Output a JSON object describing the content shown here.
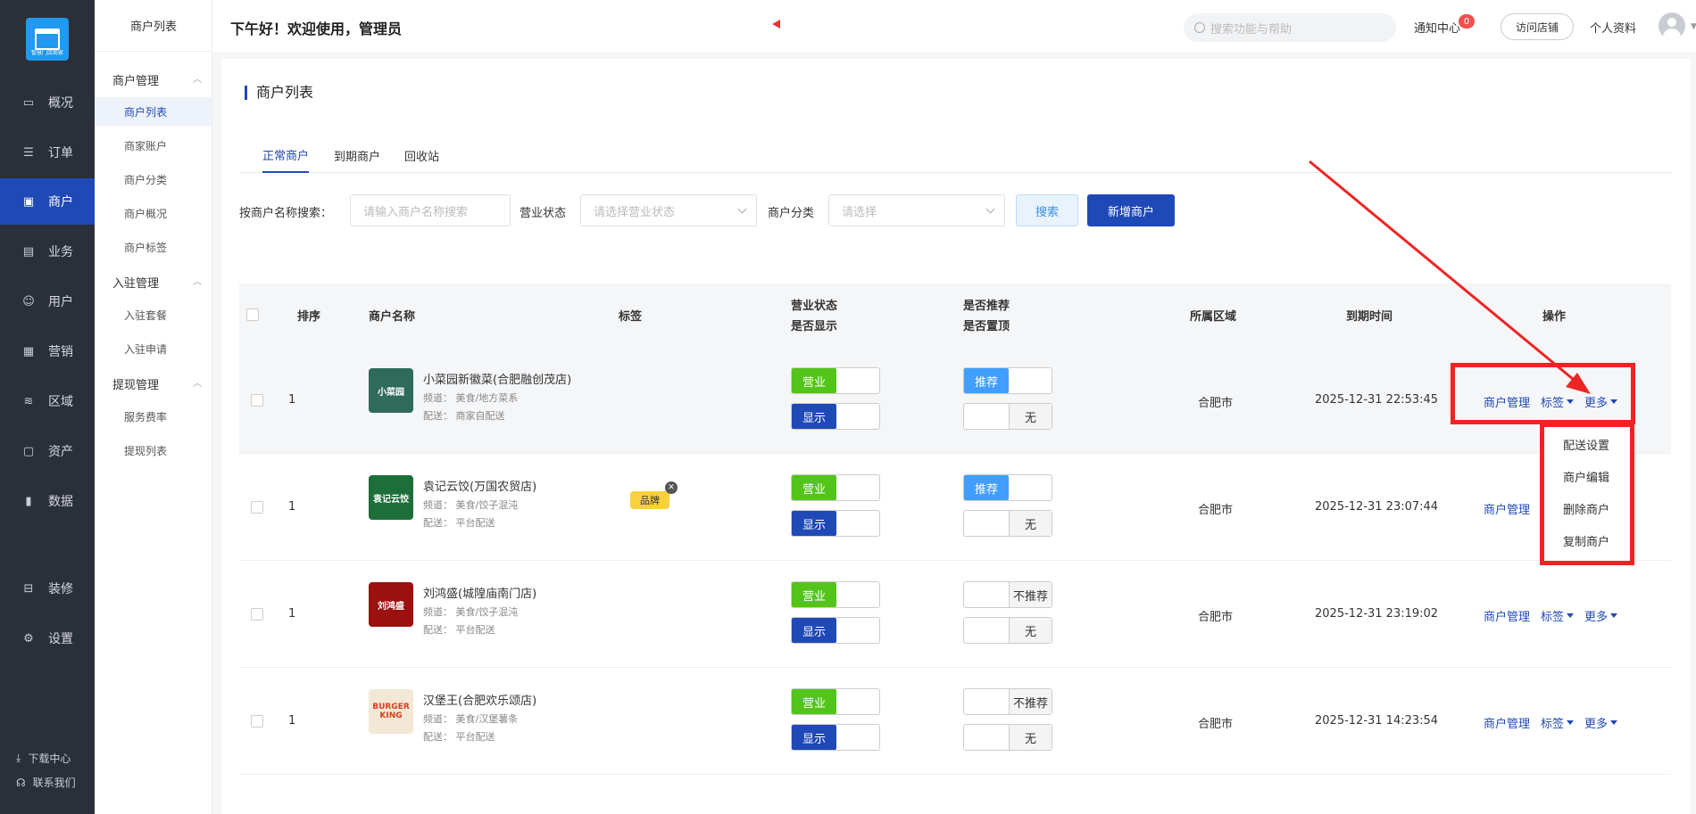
{
  "top": {
    "greeting": "下午好！欢迎使用，管理员",
    "search_placeholder": "搜索功能与帮助",
    "notice": "通知中心",
    "notice_count": "0",
    "visit_store": "访问店铺",
    "profile": "个人资料"
  },
  "sidebar": {
    "logo_caption": "智慧门店商家",
    "items": [
      {
        "label": "概况",
        "icon": "monitor-icon"
      },
      {
        "label": "订单",
        "icon": "document-icon"
      },
      {
        "label": "商户",
        "icon": "store-icon"
      },
      {
        "label": "业务",
        "icon": "briefcase-icon"
      },
      {
        "label": "用户",
        "icon": "user-icon"
      },
      {
        "label": "营销",
        "icon": "gift-icon"
      },
      {
        "label": "区域",
        "icon": "layers-icon"
      },
      {
        "label": "资产",
        "icon": "wallet-icon"
      },
      {
        "label": "数据",
        "icon": "bar-chart-icon"
      },
      {
        "label": "装修",
        "icon": "bag-icon"
      },
      {
        "label": "设置",
        "icon": "gear-icon"
      }
    ],
    "download": "下载中心",
    "contact": "联系我们"
  },
  "subnav": {
    "title": "商户列表",
    "groups": [
      {
        "label": "商户管理",
        "items": [
          "商户列表",
          "商家账户",
          "商户分类",
          "商户概况",
          "商户标签"
        ]
      },
      {
        "label": "入驻管理",
        "items": [
          "入驻套餐",
          "入驻申请"
        ]
      },
      {
        "label": "提现管理",
        "items": [
          "服务费率",
          "提现列表"
        ]
      }
    ]
  },
  "page": {
    "title": "商户列表",
    "tabs": [
      "正常商户",
      "到期商户",
      "回收站"
    ],
    "filters": {
      "name_label": "按商户名称搜索：",
      "name_placeholder": "请输入商户名称搜索",
      "status_label": "营业状态",
      "status_placeholder": "请选择营业状态",
      "category_label": "商户分类",
      "category_placeholder": "请选择",
      "search_btn": "搜索",
      "add_btn": "新增商户"
    },
    "columns": {
      "sort": "排序",
      "name": "商户名称",
      "tag": "标签",
      "status1": "营业状态",
      "status2": "是否显示",
      "rec1": "是否推荐",
      "rec2": "是否置顶",
      "region": "所属区域",
      "expire": "到期时间",
      "ops": "操作"
    },
    "rows": [
      {
        "sort": "1",
        "name": "小菜园新徽菜(合肥融创茂店)",
        "channel": "频道： 美食/地方菜系",
        "delivery": "配送： 商家自配送",
        "tag": "",
        "open": "营业",
        "show": "显示",
        "recommend": "推荐",
        "top": "无",
        "region": "合肥市",
        "expire": "2025-12-31 22:53:45",
        "logo_text": "小菜园",
        "logo_color": "#2f6b5a"
      },
      {
        "sort": "1",
        "name": "袁记云饺(万国农贸店)",
        "channel": "频道： 美食/饺子混沌",
        "delivery": "配送： 平台配送",
        "tag": "品牌",
        "open": "营业",
        "show": "显示",
        "recommend": "推荐",
        "top": "无",
        "region": "合肥市",
        "expire": "2025-12-31 23:07:44",
        "logo_text": "袁记云饺",
        "logo_color": "#1e6e3a"
      },
      {
        "sort": "1",
        "name": "刘鸿盛(城隍庙南门店)",
        "channel": "频道： 美食/饺子混沌",
        "delivery": "配送： 平台配送",
        "tag": "",
        "open": "营业",
        "show": "显示",
        "recommend": "不推荐",
        "top": "无",
        "region": "合肥市",
        "expire": "2025-12-31 23:19:02",
        "logo_text": "刘鸿盛",
        "logo_color": "#9c1010"
      },
      {
        "sort": "1",
        "name": "汉堡王(合肥欢乐颂店)",
        "channel": "频道： 美食/汉堡薯条",
        "delivery": "配送： 平台配送",
        "tag": "",
        "open": "营业",
        "show": "显示",
        "recommend": "不推荐",
        "top": "无",
        "region": "合肥市",
        "expire": "2025-12-31 14:23:54",
        "logo_text": "BURGER KING",
        "logo_color": "#f3e7d6"
      }
    ],
    "ops": {
      "manage": "商户管理",
      "tag": "标签",
      "more": "更多"
    },
    "dropdown": [
      "配送设置",
      "商户编辑",
      "删除商户",
      "复制商户"
    ]
  },
  "colors": {
    "primary": "#1f49b6",
    "green": "#52c41a",
    "annotation": "#ee2424"
  }
}
